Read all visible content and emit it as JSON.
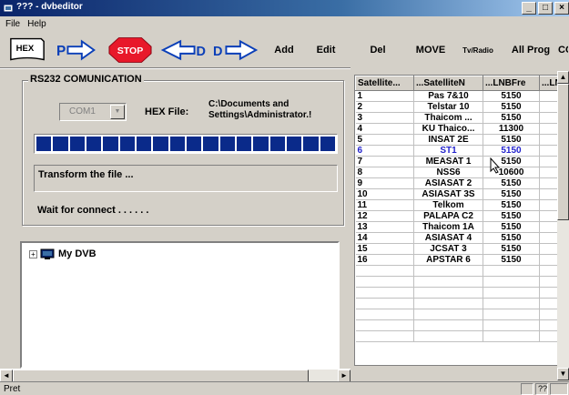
{
  "window": {
    "title": "??? - dvbeditor",
    "minimize": "_",
    "maximize": "□",
    "close": "×"
  },
  "menu": [
    "File",
    "Help"
  ],
  "toolbar": {
    "hex_label": "HEX",
    "pc_label": "P",
    "stop_label": "STOP",
    "d_left_label": "D",
    "d_right_label": "D",
    "add": "Add",
    "edit": "Edit",
    "del": "Del",
    "move": "MOVE",
    "tvradio": "Tv/Radio",
    "allprog": "All Prog",
    "more": "CC"
  },
  "rs232": {
    "title": "RS232 COMUNICATION",
    "port": "COM1",
    "hex_file_label": "HEX File:",
    "hex_path_line1": "C:\\Documents and",
    "hex_path_line2": "Settings\\Administrator.!",
    "progress": 1.0,
    "progress_blocks": 18,
    "status": "Transform the file ...",
    "wait": "Wait for connect . . . . . ."
  },
  "tree": {
    "expander": "+",
    "root": "My DVB"
  },
  "grid": {
    "columns": [
      "Satellite...",
      "...SatelliteN",
      "...LNBFre",
      "...LN"
    ],
    "rows": [
      [
        "1",
        "Pas 7&10",
        "5150",
        ""
      ],
      [
        "2",
        "Telstar 10",
        "5150",
        ""
      ],
      [
        "3",
        "Thaicom ...",
        "5150",
        ""
      ],
      [
        "4",
        "KU Thaico...",
        "11300",
        ""
      ],
      [
        "5",
        "INSAT 2E",
        "5150",
        ""
      ],
      [
        "6",
        "ST1",
        "5150",
        ""
      ],
      [
        "7",
        "MEASAT 1",
        "5150",
        ""
      ],
      [
        "8",
        "NSS6",
        "10600",
        ""
      ],
      [
        "9",
        "ASIASAT 2",
        "5150",
        ""
      ],
      [
        "10",
        "ASIASAT 3S",
        "5150",
        ""
      ],
      [
        "11",
        "Telkom",
        "5150",
        ""
      ],
      [
        "12",
        "PALAPA C2",
        "5150",
        ""
      ],
      [
        "13",
        "Thaicom 1A",
        "5150",
        ""
      ],
      [
        "14",
        "ASIASAT 4",
        "5150",
        ""
      ],
      [
        "15",
        "JCSAT 3",
        "5150",
        ""
      ],
      [
        "16",
        "APSTAR 6",
        "5150",
        ""
      ]
    ],
    "selected_row": 5,
    "empty_rows": 7
  },
  "scroll": {
    "left": "◄",
    "right": "►",
    "up": "▲",
    "down": "▼"
  },
  "statusbar": {
    "text": "Pret",
    "cell": "??"
  },
  "colors": {
    "title_start": "#0a246a",
    "title_end": "#a6caf0",
    "progress": "#0a2a8a",
    "stop_red": "#e8182a",
    "arrow_blue": "#0b3fb8",
    "selected_text": "#2222cc"
  }
}
